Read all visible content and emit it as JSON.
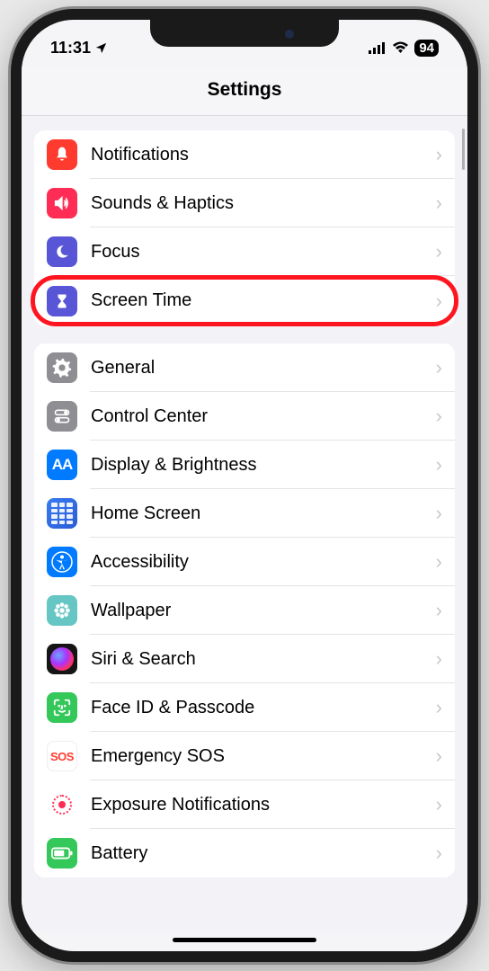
{
  "status": {
    "time": "11:31",
    "battery": "94"
  },
  "page": {
    "title": "Settings"
  },
  "groups": [
    {
      "items": [
        {
          "id": "notifications",
          "label": "Notifications",
          "icon": "bell-icon",
          "bg": "bg-red",
          "highlighted": false
        },
        {
          "id": "sounds-haptics",
          "label": "Sounds & Haptics",
          "icon": "speaker-icon",
          "bg": "bg-pink",
          "highlighted": false
        },
        {
          "id": "focus",
          "label": "Focus",
          "icon": "moon-icon",
          "bg": "bg-indigo",
          "highlighted": false
        },
        {
          "id": "screen-time",
          "label": "Screen Time",
          "icon": "hourglass-icon",
          "bg": "bg-indigo",
          "highlighted": true
        }
      ]
    },
    {
      "items": [
        {
          "id": "general",
          "label": "General",
          "icon": "gear-icon",
          "bg": "bg-gray",
          "highlighted": false
        },
        {
          "id": "control-center",
          "label": "Control Center",
          "icon": "toggles-icon",
          "bg": "bg-gray",
          "highlighted": false
        },
        {
          "id": "display-brightness",
          "label": "Display & Brightness",
          "icon": "aa-icon",
          "bg": "bg-blue",
          "highlighted": false
        },
        {
          "id": "home-screen",
          "label": "Home Screen",
          "icon": "home-grid-icon",
          "bg": "bg-gradient-blue",
          "highlighted": false
        },
        {
          "id": "accessibility",
          "label": "Accessibility",
          "icon": "accessibility-icon",
          "bg": "bg-blue",
          "highlighted": false
        },
        {
          "id": "wallpaper",
          "label": "Wallpaper",
          "icon": "flower-icon",
          "bg": "bg-teal",
          "highlighted": false
        },
        {
          "id": "siri-search",
          "label": "Siri & Search",
          "icon": "siri-icon",
          "bg": "bg-black",
          "highlighted": false
        },
        {
          "id": "face-id-passcode",
          "label": "Face ID & Passcode",
          "icon": "faceid-icon",
          "bg": "bg-green",
          "highlighted": false
        },
        {
          "id": "emergency-sos",
          "label": "Emergency SOS",
          "icon": "sos-icon",
          "bg": "bg-white-red",
          "highlighted": false
        },
        {
          "id": "exposure-notifications",
          "label": "Exposure Notifications",
          "icon": "exposure-icon",
          "bg": "",
          "highlighted": false
        },
        {
          "id": "battery",
          "label": "Battery",
          "icon": "battery-icon",
          "bg": "bg-green",
          "highlighted": false
        }
      ]
    }
  ]
}
